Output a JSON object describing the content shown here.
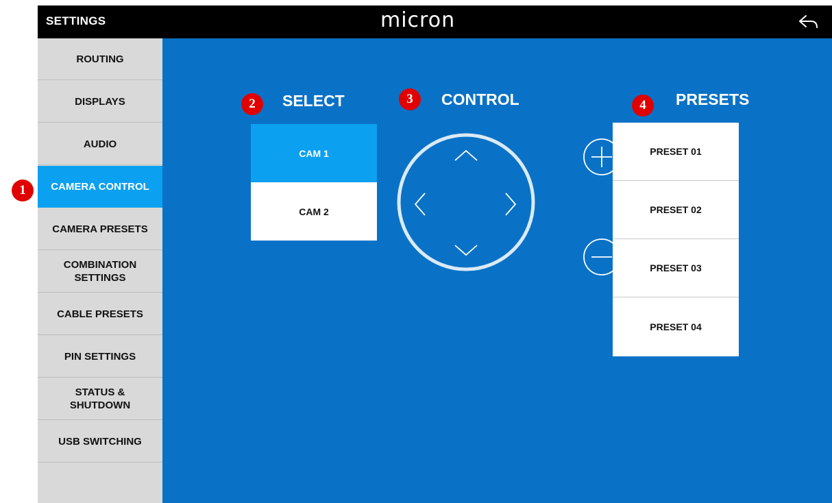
{
  "header": {
    "title": "SETTINGS",
    "logo": "micron",
    "back_icon": "back-arrow-icon"
  },
  "sidebar": {
    "items": [
      {
        "label": "ROUTING",
        "active": false
      },
      {
        "label": "DISPLAYS",
        "active": false
      },
      {
        "label": "AUDIO",
        "active": false
      },
      {
        "label": "CAMERA CONTROL",
        "active": true
      },
      {
        "label": "CAMERA PRESETS",
        "active": false
      },
      {
        "label": "COMBINATION\nSETTINGS",
        "active": false
      },
      {
        "label": "CABLE PRESETS",
        "active": false
      },
      {
        "label": "PIN SETTINGS",
        "active": false
      },
      {
        "label": "STATUS &\nSHUTDOWN",
        "active": false
      },
      {
        "label": "USB SWITCHING",
        "active": false
      }
    ]
  },
  "sections": {
    "select": {
      "heading": "SELECT",
      "badge": "2"
    },
    "control": {
      "heading": "CONTROL",
      "badge": "3"
    },
    "presets": {
      "heading": "PRESETS",
      "badge": "4"
    }
  },
  "annotations": {
    "sidebar_badge": "1"
  },
  "cameras": [
    {
      "label": "CAM 1",
      "selected": true
    },
    {
      "label": "CAM 2",
      "selected": false
    }
  ],
  "presets": [
    "PRESET 01",
    "PRESET 02",
    "PRESET 03",
    "PRESET 04"
  ],
  "controls": {
    "dpad_icons": [
      "chevron-up-icon",
      "chevron-left-icon",
      "chevron-right-icon",
      "chevron-down-icon"
    ],
    "zoom_in_icon": "plus-icon",
    "zoom_out_icon": "minus-icon"
  },
  "colors": {
    "main_bg": "#0a72c6",
    "active": "#0ca0f0",
    "sidebar_bg": "#d9d9d9",
    "badge": "#e00000"
  }
}
